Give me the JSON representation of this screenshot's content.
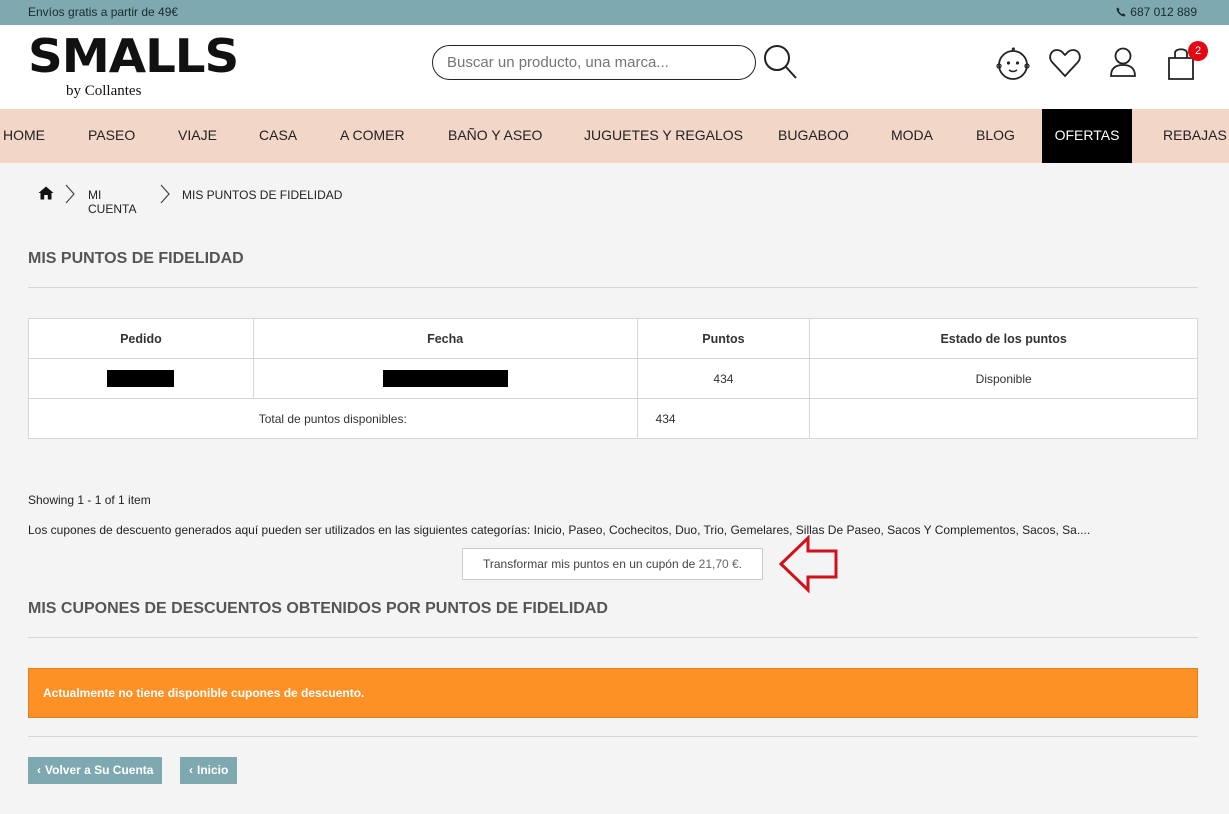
{
  "topbar": {
    "promo": "Envíos gratis a partir de 49€",
    "phone": "687 012 889"
  },
  "header": {
    "logo_brand": "SMALLS",
    "logo_sub": "by Collantes",
    "search_placeholder": "Buscar un producto, una marca...",
    "cart_count": "2"
  },
  "nav": {
    "items": [
      "HOME",
      "PASEO",
      "VIAJE",
      "CASA",
      "A COMER",
      "BAÑO Y ASEO",
      "JUGUETES Y REGALOS",
      "BUGABOO",
      "MODA",
      "BLOG",
      "OFERTAS",
      "REBAJAS"
    ]
  },
  "breadcrumb": {
    "items": [
      "MI CUENTA",
      "MIS PUNTOS DE FIDELIDAD"
    ]
  },
  "page": {
    "title": "MIS PUNTOS DE FIDELIDAD",
    "table": {
      "headers": [
        "Pedido",
        "Fecha",
        "Puntos",
        "Estado de los puntos"
      ],
      "row": {
        "puntos": "434",
        "estado": "Disponible"
      },
      "total_label": "Total de puntos disponibles:",
      "total_value": "434"
    },
    "showing": "Showing 1 - 1 of 1 item",
    "categories_text": "Los cupones de descuento generados aquí pueden ser utilizados en las siguientes categorías: Inicio, Paseo, Cochecitos, Duo, Trio, Gemelares, Sillas De Paseo, Sacos Y Complementos, Sacos, Sa....",
    "transform_label": "Transformar mis puntos en un cupón de",
    "transform_amount": "21,70 €.",
    "coupons_title": "MIS CUPONES DE DESCUENTOS OBTENIDOS POR PUNTOS DE FIDELIDAD",
    "alert": "Actualmente no tiene disponible cupones de descuento.",
    "back_account": "Volver a Su Cuenta",
    "back_home": "Inicio"
  },
  "colors": {
    "topbar": "#7ea9b0",
    "nav": "#f2d6c8",
    "alert": "#fe9126",
    "badge": "#e30613",
    "annotation_arrow": "#d0101b"
  }
}
